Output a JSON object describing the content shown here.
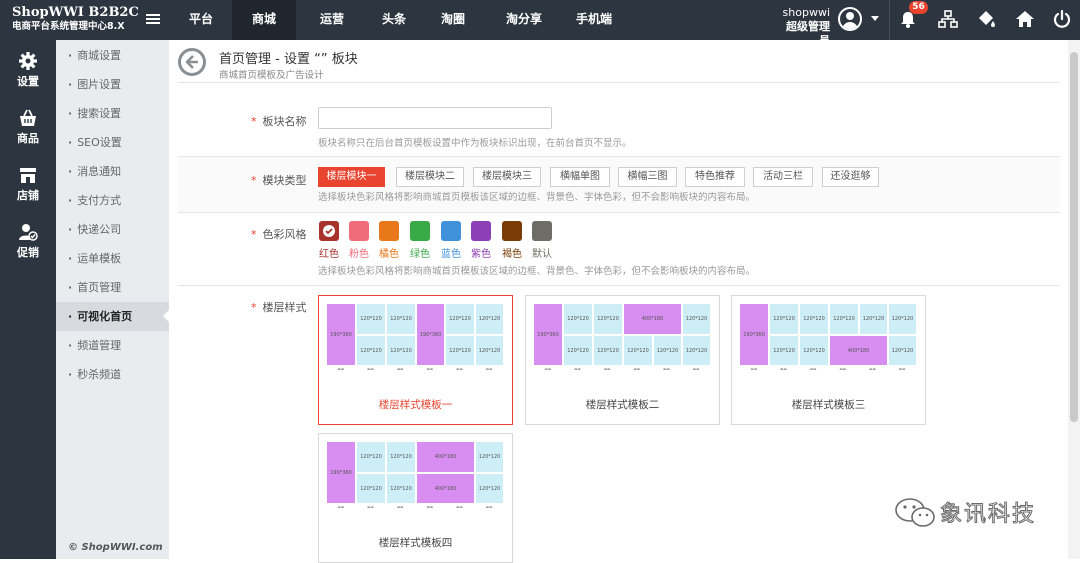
{
  "header": {
    "brand_name": "ShopWWI B2B2C",
    "brand_subtitle": "电商平台系统管理中心8.X",
    "nav": [
      {
        "label": "平台",
        "active": false
      },
      {
        "label": "商城",
        "active": true
      },
      {
        "label": "运营",
        "active": false
      },
      {
        "label": "头条",
        "active": false
      },
      {
        "label": "淘圈",
        "active": false
      },
      {
        "label": "淘分享",
        "active": false
      },
      {
        "label": "手机端",
        "active": false
      }
    ],
    "user_name": "shopwwi",
    "user_role": "超级管理员",
    "notification_count": "56",
    "icons": [
      "menu-icon",
      "user-avatar-icon",
      "bell-icon",
      "sitemap-icon",
      "paint-bucket-icon",
      "home-icon",
      "power-icon"
    ]
  },
  "sidebar": {
    "items": [
      {
        "label": "设置",
        "icon": "gear-icon"
      },
      {
        "label": "商品",
        "icon": "basket-icon"
      },
      {
        "label": "店铺",
        "icon": "store-icon"
      },
      {
        "label": "促销",
        "icon": "promotion-icon"
      }
    ]
  },
  "subnav": {
    "items": [
      {
        "label": "商城设置"
      },
      {
        "label": "图片设置"
      },
      {
        "label": "搜索设置"
      },
      {
        "label": "SEO设置"
      },
      {
        "label": "消息通知"
      },
      {
        "label": "支付方式"
      },
      {
        "label": "快递公司"
      },
      {
        "label": "运单模板"
      },
      {
        "label": "首页管理"
      },
      {
        "label": "可视化首页",
        "active": true
      },
      {
        "label": "频道管理"
      },
      {
        "label": "秒杀频道"
      }
    ],
    "copyright": "© ShopWWI.com"
  },
  "page": {
    "title": "首页管理 - 设置 “” 板块",
    "subtitle": "商城首页模板及广告设计"
  },
  "form": {
    "name_field": {
      "label": "板块名称",
      "value": "",
      "hint": "板块名称只在后台首页模板设置中作为板块标识出现，在前台首页不显示。"
    },
    "type_field": {
      "label": "模块类型",
      "options": [
        "楼层模块一",
        "楼层模块二",
        "楼层模块三",
        "横幅单图",
        "横幅三图",
        "特色推荐",
        "活动三栏",
        "还没逛够"
      ],
      "selected": "楼层模块一",
      "hint": "选择板块色彩风格将影响商城首页模板该区域的边框、背景色、字体色彩，但不会影响板块的内容布局。"
    },
    "color_field": {
      "label": "色彩风格",
      "options": [
        {
          "name": "红色",
          "color": "#a8322c",
          "selected": true
        },
        {
          "name": "粉色",
          "color": "#f06c7a"
        },
        {
          "name": "橘色",
          "color": "#e9781a"
        },
        {
          "name": "绿色",
          "color": "#3aaa47"
        },
        {
          "name": "蓝色",
          "color": "#3f92d9"
        },
        {
          "name": "紫色",
          "color": "#8d3fb7"
        },
        {
          "name": "褐色",
          "color": "#7a3c06"
        },
        {
          "name": "默认",
          "color": "#6d6d65"
        }
      ],
      "hint": "选择板块色彩风格将影响商城首页模板该区域的边框、背景色、字体色彩，但不会影响板块的内容布局。"
    },
    "style_field": {
      "label": "楼层样式",
      "templates": [
        {
          "title": "楼层样式模板一",
          "selected": true
        },
        {
          "title": "楼层样式模板二"
        },
        {
          "title": "楼层样式模板三"
        },
        {
          "title": "楼层样式模板四"
        }
      ],
      "cell_labels": {
        "tall": "190*360",
        "small": "120*120",
        "wide": "400*180"
      }
    }
  },
  "watermark": {
    "text": "象讯科技",
    "icon": "wechat-icon"
  },
  "colors": {
    "accent": "#e8442f",
    "topbar": "#2d3640",
    "subnav": "#e9ecef"
  }
}
